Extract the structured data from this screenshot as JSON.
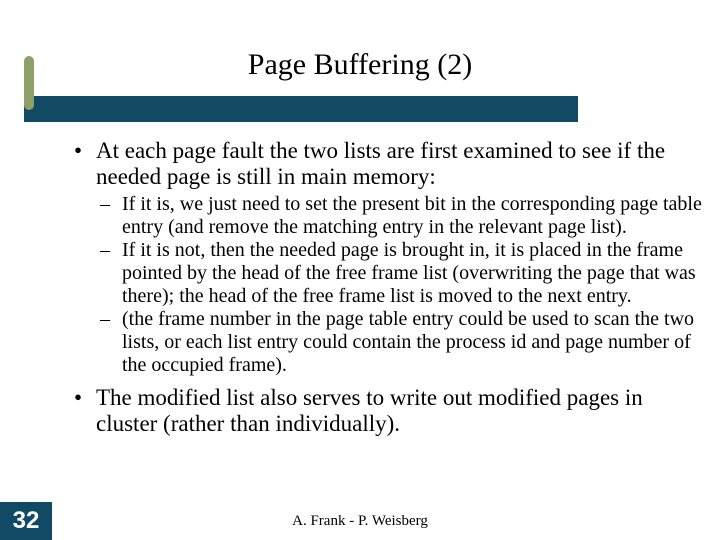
{
  "title": "Page Buffering (2)",
  "bullets": [
    {
      "text": "At each page fault the two lists are first examined to see if the needed page is still in main memory:",
      "sub": [
        "If it is, we just need to set the present bit in the corresponding page table entry (and remove the matching entry in the relevant page list).",
        "If it is not, then the needed page is brought in, it is placed in the frame pointed by the head of the free frame list (overwriting the page that was there); the head of the free frame list is moved to the next entry.",
        "(the frame number in the page table entry could be used to scan the two lists, or each list entry could contain the process id and page number of the occupied frame)."
      ]
    },
    {
      "text": "The modified list also serves to write out modified pages in cluster (rather than individually)."
    }
  ],
  "page_number": "32",
  "footer": "A. Frank - P. Weisberg"
}
